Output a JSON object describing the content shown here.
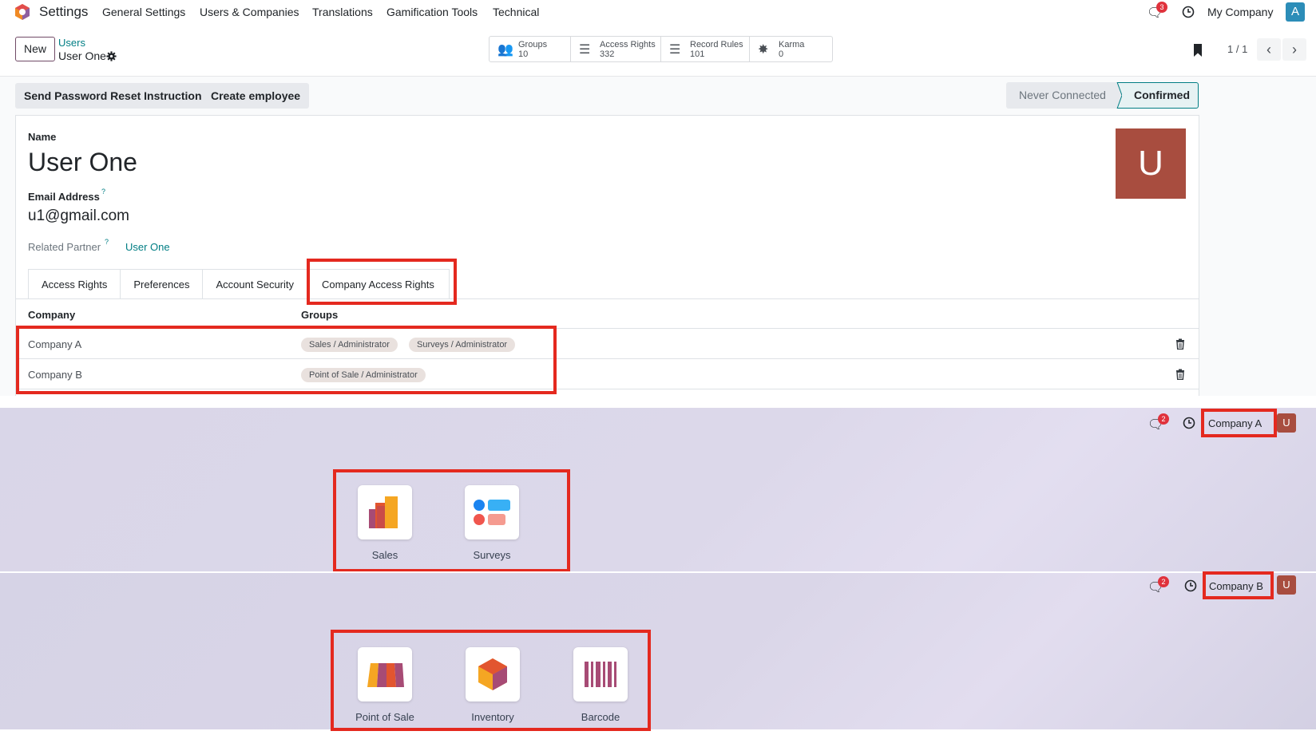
{
  "navbar": {
    "app_title": "Settings",
    "menu": [
      "General Settings",
      "Users & Companies",
      "Translations",
      "Gamification Tools",
      "Technical"
    ],
    "message_count": "3",
    "company": "My Company",
    "avatar_letter": "A"
  },
  "control": {
    "new_label": "New",
    "breadcrumb_parent": "Users",
    "breadcrumb_current": "User One",
    "smart_buttons": [
      {
        "label": "Groups",
        "value": "10"
      },
      {
        "label": "Access Rights",
        "value": "332"
      },
      {
        "label": "Record Rules",
        "value": "101"
      },
      {
        "label": "Karma",
        "value": "0"
      }
    ],
    "pager": "1 / 1"
  },
  "actions": {
    "reset_password": "Send Password Reset Instructions",
    "create_employee": "Create employee",
    "status_never": "Never Connected",
    "status_confirmed": "Confirmed"
  },
  "form": {
    "name_label": "Name",
    "name_value": "User One",
    "email_label": "Email Address",
    "email_value": "u1@gmail.com",
    "partner_label": "Related Partner",
    "partner_value": "User One",
    "avatar_letter": "U",
    "help_mark": "?"
  },
  "tabs": [
    "Access Rights",
    "Preferences",
    "Account Security",
    "Company Access Rights"
  ],
  "table": {
    "headers": [
      "Company",
      "Groups"
    ],
    "rows": [
      {
        "company": "Company A",
        "groups": [
          "Sales / Administrator",
          "Surveys / Administrator"
        ]
      },
      {
        "company": "Company B",
        "groups": [
          "Point of Sale / Administrator"
        ]
      }
    ]
  },
  "screen_a": {
    "message_count": "2",
    "company": "Company A",
    "avatar_letter": "U",
    "apps": [
      "Sales",
      "Surveys"
    ]
  },
  "screen_b": {
    "message_count": "2",
    "company": "Company B",
    "avatar_letter": "U",
    "apps": [
      "Point of Sale",
      "Inventory",
      "Barcode"
    ]
  },
  "colors": {
    "brand": "#714b67",
    "link": "#017e84",
    "highlight": "#e4291f",
    "avatar": "#a84d3f"
  }
}
